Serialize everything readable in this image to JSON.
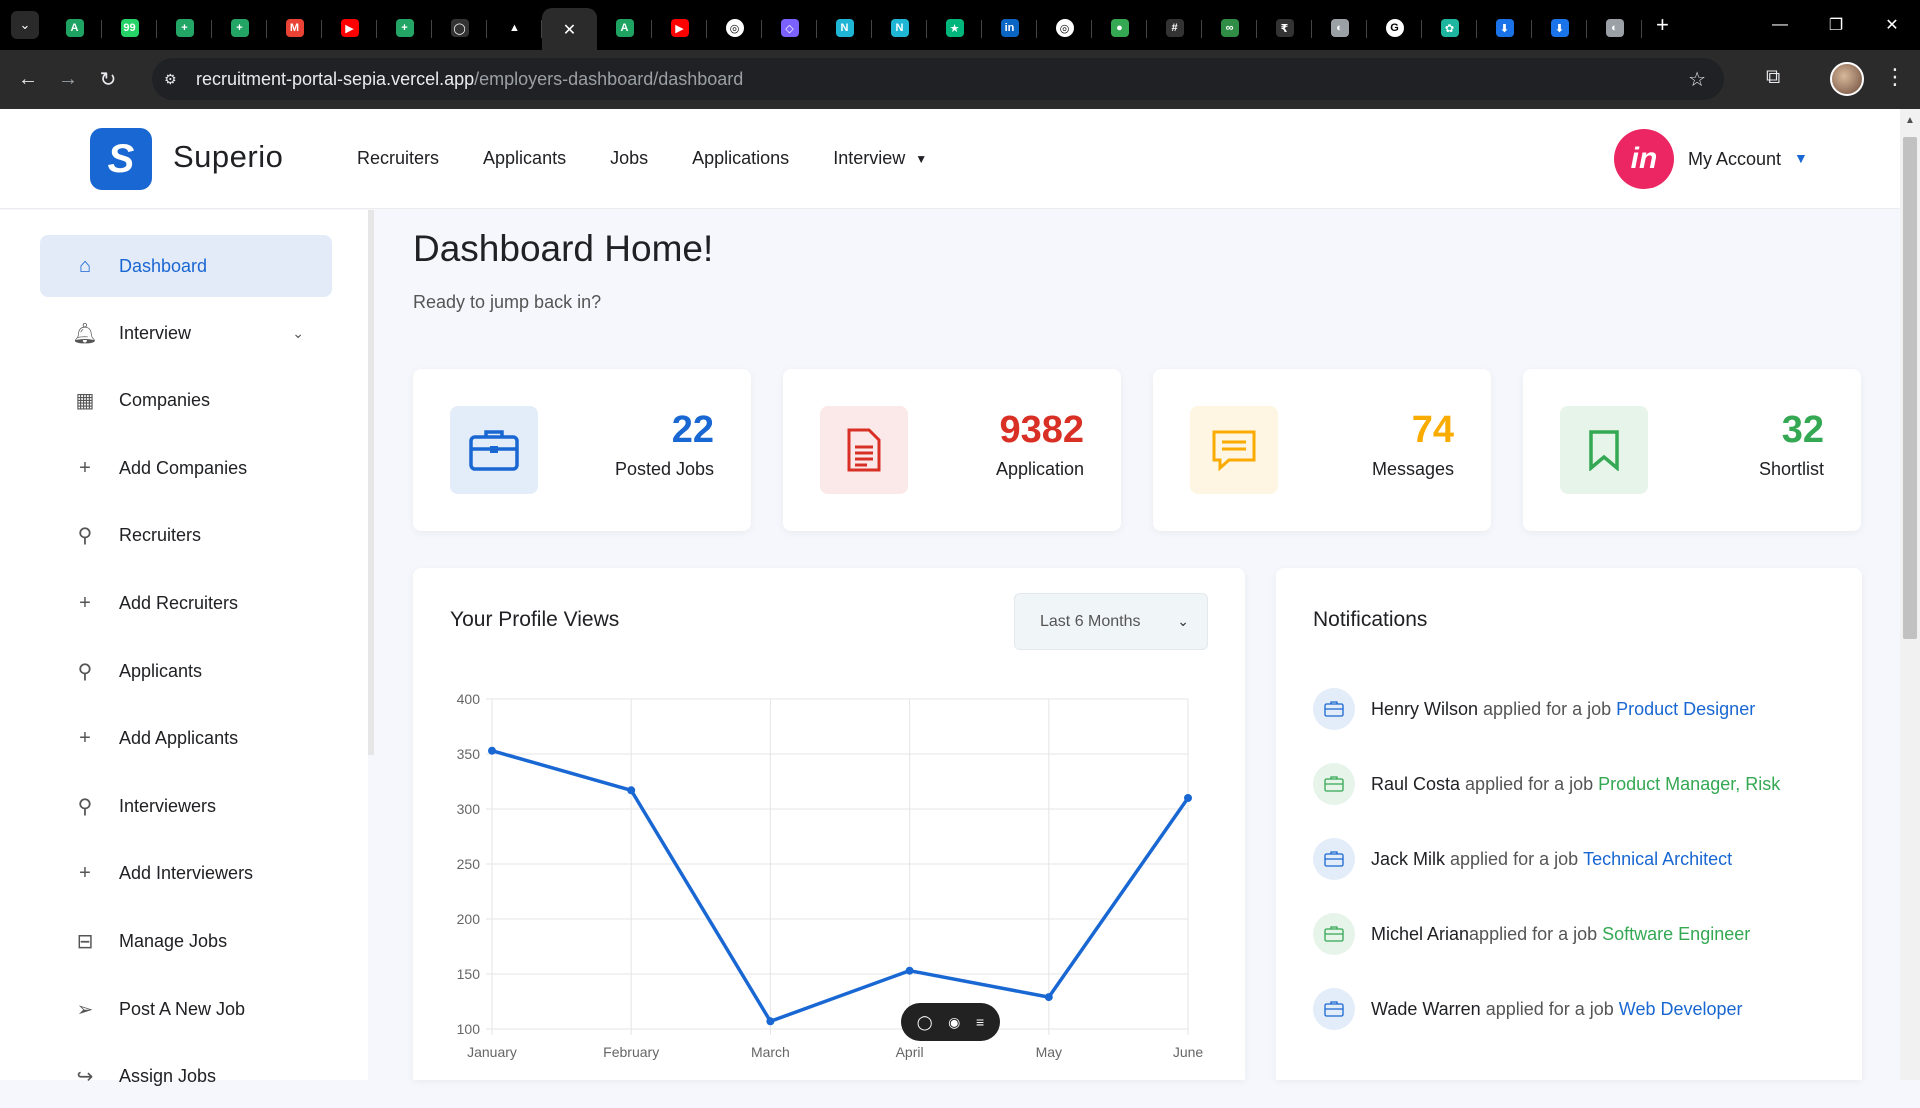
{
  "browser": {
    "url_host": "recruitment-portal-sepia.vercel.app",
    "url_path": "/employers-dashboard/dashboard",
    "tabs": [
      {
        "icon": "sheets-icon",
        "color": "#1ea362",
        "glyph": "A"
      },
      {
        "icon": "whatsapp-icon",
        "color": "#25d366",
        "glyph": "99"
      },
      {
        "icon": "sheets-icon",
        "color": "#23a566",
        "glyph": "+"
      },
      {
        "icon": "sheets-icon",
        "color": "#23a566",
        "glyph": "+"
      },
      {
        "icon": "meet-icon",
        "color": "#ea4335",
        "glyph": "M"
      },
      {
        "icon": "youtube-icon",
        "color": "#ff0000",
        "glyph": "▶"
      },
      {
        "icon": "sheets-icon",
        "color": "#23a566",
        "glyph": "+"
      },
      {
        "icon": "github-icon",
        "color": "#333333",
        "glyph": "◯"
      },
      {
        "icon": "vercel-icon",
        "color": "#000000",
        "glyph": "▲"
      },
      {
        "icon": "close-icon",
        "color": "#2b2b2b",
        "glyph": "✕",
        "active": true
      },
      {
        "icon": "sheets-icon",
        "color": "#1ea362",
        "glyph": "A"
      },
      {
        "icon": "youtube-icon",
        "color": "#ff0000",
        "glyph": "▶"
      },
      {
        "icon": "chatgpt-icon",
        "color": "#ffffff",
        "glyph": "◎"
      },
      {
        "icon": "shield-icon",
        "color": "#7b61ff",
        "glyph": "◇"
      },
      {
        "icon": "n-icon",
        "color": "#1fb6d6",
        "glyph": "N"
      },
      {
        "icon": "n-icon",
        "color": "#1fb6d6",
        "glyph": "N"
      },
      {
        "icon": "star-icon",
        "color": "#00b67a",
        "glyph": "★"
      },
      {
        "icon": "linkedin-icon",
        "color": "#0a66c2",
        "glyph": "in"
      },
      {
        "icon": "chatgpt-icon",
        "color": "#ffffff",
        "glyph": "◎"
      },
      {
        "icon": "people-icon",
        "color": "#34a853",
        "glyph": "●"
      },
      {
        "icon": "hash-icon",
        "color": "#333333",
        "glyph": "#"
      },
      {
        "icon": "gfg-icon",
        "color": "#2f8d46",
        "glyph": "∞"
      },
      {
        "icon": "rupee-icon",
        "color": "#333333",
        "glyph": "₹"
      },
      {
        "icon": "globe-icon",
        "color": "#9aa0a6",
        "glyph": "◐"
      },
      {
        "icon": "google-icon",
        "color": "#ffffff",
        "glyph": "G"
      },
      {
        "icon": "apps-icon",
        "color": "#1fb6a0",
        "glyph": "✿"
      },
      {
        "icon": "person-icon",
        "color": "#1a73e8",
        "glyph": "⬇"
      },
      {
        "icon": "download-icon",
        "color": "#1a73e8",
        "glyph": "⬇"
      },
      {
        "icon": "globe-icon",
        "color": "#9aa0a6",
        "glyph": "◐"
      }
    ]
  },
  "header": {
    "brand": "Superio",
    "nav": [
      "Recruiters",
      "Applicants",
      "Jobs",
      "Applications"
    ],
    "nav_dropdown": "Interview",
    "account": "My Account",
    "avatar_text": "in"
  },
  "sidebar": {
    "items": [
      {
        "label": "Dashboard",
        "icon": "home-icon",
        "glyph": "⌂",
        "active": true
      },
      {
        "label": "Interview",
        "icon": "bell-icon",
        "glyph": "🔔︎",
        "chevron": true
      },
      {
        "label": "Companies",
        "icon": "building-icon",
        "glyph": "▦"
      },
      {
        "label": "Add Companies",
        "icon": "plus-icon",
        "glyph": "+"
      },
      {
        "label": "Recruiters",
        "icon": "user-icon",
        "glyph": "⚲"
      },
      {
        "label": "Add Recruiters",
        "icon": "plus-icon",
        "glyph": "+"
      },
      {
        "label": "Applicants",
        "icon": "user-icon",
        "glyph": "⚲"
      },
      {
        "label": "Add Applicants",
        "icon": "plus-icon",
        "glyph": "+"
      },
      {
        "label": "Interviewers",
        "icon": "user-icon",
        "glyph": "⚲"
      },
      {
        "label": "Add Interviewers",
        "icon": "plus-icon",
        "glyph": "+"
      },
      {
        "label": "Manage Jobs",
        "icon": "briefcase-icon",
        "glyph": "⊟"
      },
      {
        "label": "Post A New Job",
        "icon": "send-icon",
        "glyph": "➢"
      },
      {
        "label": "Assign Jobs",
        "icon": "share-icon",
        "glyph": "↪"
      }
    ]
  },
  "main": {
    "title": "Dashboard Home!",
    "subtitle": "Ready to jump back in?",
    "stats": [
      {
        "value": "22",
        "label": "Posted Jobs",
        "color": "#1967d2",
        "bg": "#e3ecf9",
        "icon": "briefcase-icon"
      },
      {
        "value": "9382",
        "label": "Application",
        "color": "#d93025",
        "bg": "#fbe9e9",
        "icon": "document-icon"
      },
      {
        "value": "74",
        "label": "Messages",
        "color": "#f9ab00",
        "bg": "#fef5e3",
        "icon": "message-icon"
      },
      {
        "value": "32",
        "label": "Shortlist",
        "color": "#34a853",
        "bg": "#e6f4ea",
        "icon": "bookmark-icon"
      }
    ],
    "profile_views": {
      "title": "Your Profile Views",
      "range": "Last 6 Months"
    },
    "notifications": {
      "title": "Notifications",
      "items": [
        {
          "name": "Henry Wilson",
          "text": " applied for a job ",
          "job": "Product Designer",
          "color": "#1967d2",
          "bg": "#e3ecf9"
        },
        {
          "name": "Raul Costa",
          "text": " applied for a job ",
          "job": "Product Manager, Risk",
          "color": "#34a853",
          "bg": "#e6f4ea"
        },
        {
          "name": "Jack Milk",
          "text": " applied for a job ",
          "job": "Technical Architect",
          "color": "#1967d2",
          "bg": "#e3ecf9"
        },
        {
          "name": "Michel Arian",
          "text": "applied for a job ",
          "job": "Software Engineer",
          "color": "#34a853",
          "bg": "#e6f4ea"
        },
        {
          "name": "Wade Warren",
          "text": " applied for a job ",
          "job": "Web Developer",
          "color": "#1967d2",
          "bg": "#e3ecf9"
        }
      ]
    }
  },
  "chart_data": {
    "type": "line",
    "categories": [
      "January",
      "February",
      "March",
      "April",
      "May",
      "June"
    ],
    "values": [
      353,
      317,
      107,
      153,
      129,
      310
    ],
    "ylim": [
      100,
      400
    ],
    "yticks": [
      100,
      150,
      200,
      250,
      300,
      350,
      400
    ],
    "color": "#1967d2",
    "grid": true
  }
}
